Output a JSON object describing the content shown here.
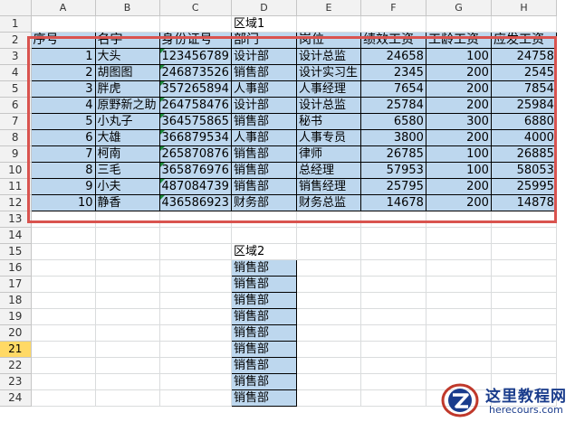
{
  "columns": [
    "A",
    "B",
    "C",
    "D",
    "E",
    "F",
    "G",
    "H"
  ],
  "rows": [
    "1",
    "2",
    "3",
    "4",
    "5",
    "6",
    "7",
    "8",
    "9",
    "10",
    "11",
    "12",
    "13",
    "14",
    "15",
    "16",
    "17",
    "18",
    "19",
    "20",
    "21",
    "22",
    "23",
    "24"
  ],
  "selected_row": "21",
  "region1_label": "区域1",
  "region2_label": "区域2",
  "table_headers": [
    "序号",
    "名字",
    "身份证号",
    "部门",
    "岗位",
    "绩效工资",
    "工龄工资",
    "应发工资"
  ],
  "table_rows": [
    [
      "1",
      "大头",
      "123456789",
      "设计部",
      "设计总监",
      "24658",
      "100",
      "24758"
    ],
    [
      "2",
      "胡图图",
      "246873526",
      "销售部",
      "设计实习生",
      "2345",
      "200",
      "2545"
    ],
    [
      "3",
      "胖虎",
      "357265894",
      "人事部",
      "人事经理",
      "7654",
      "200",
      "7854"
    ],
    [
      "4",
      "原野新之助",
      "264758476",
      "设计部",
      "设计总监",
      "25784",
      "200",
      "25984"
    ],
    [
      "5",
      "小丸子",
      "364575865",
      "销售部",
      "秘书",
      "6580",
      "300",
      "6880"
    ],
    [
      "6",
      "大雄",
      "366879534",
      "人事部",
      "人事专员",
      "3800",
      "200",
      "4000"
    ],
    [
      "7",
      "柯南",
      "265870876",
      "销售部",
      "律师",
      "26785",
      "100",
      "26885"
    ],
    [
      "8",
      "三毛",
      "365876976",
      "销售部",
      "总经理",
      "57953",
      "100",
      "58053"
    ],
    [
      "9",
      "小夫",
      "487084739",
      "销售部",
      "销售经理",
      "25795",
      "200",
      "25995"
    ],
    [
      "10",
      "静香",
      "436586923",
      "财务部",
      "财务总监",
      "14678",
      "200",
      "14878"
    ]
  ],
  "region2_values": [
    "销售部",
    "销售部",
    "销售部",
    "销售部",
    "销售部",
    "销售部",
    "销售部",
    "销售部",
    "销售部"
  ],
  "watermark": {
    "title": "这里教程网",
    "url": "herecours.com"
  },
  "colors": {
    "fill": "#bdd7ee",
    "highlight": "#d9534f",
    "selected_row": "#ffd965"
  }
}
